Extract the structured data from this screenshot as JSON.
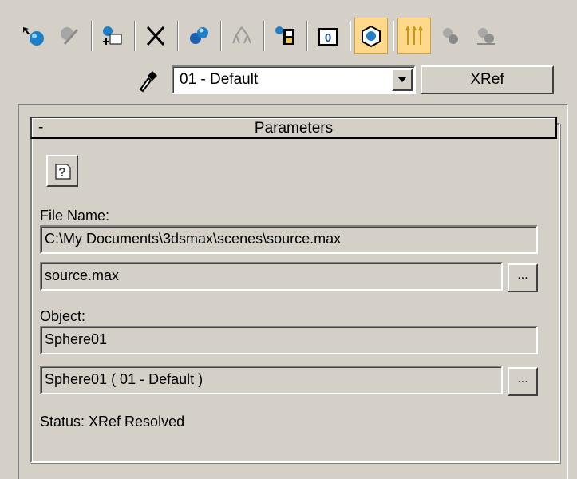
{
  "toolbar": {
    "buttons": [
      {
        "name": "pick-object-icon"
      },
      {
        "name": "put-to-library-icon"
      },
      {
        "name": "make-unique-icon"
      },
      {
        "name": "delete-icon"
      },
      {
        "name": "assign-material-icon"
      },
      {
        "name": "go-to-parent-icon"
      },
      {
        "name": "get-material-icon"
      },
      {
        "name": "material-effects-channel-icon"
      },
      {
        "name": "show-map-in-viewport-icon"
      },
      {
        "name": "show-end-result-icon"
      },
      {
        "name": "go-forward-sibling-icon"
      },
      {
        "name": "go-to-sibling-icon"
      }
    ]
  },
  "material": {
    "selected": "01 - Default",
    "type_button": "XRef"
  },
  "rollout": {
    "collapse_symbol": "-",
    "title": "Parameters"
  },
  "file": {
    "label": "File Name:",
    "path": "C:\\My Documents\\3dsmax\\scenes\\source.max",
    "name": "source.max",
    "browse_label": "..."
  },
  "object": {
    "label": "Object:",
    "value": "Sphere01",
    "material": "Sphere01 ( 01 - Default )",
    "browse_label": "..."
  },
  "status": {
    "text": "Status: XRef Resolved"
  },
  "colors": {
    "background": "#d4d0c8",
    "active_toggle": "#ffd98a"
  }
}
